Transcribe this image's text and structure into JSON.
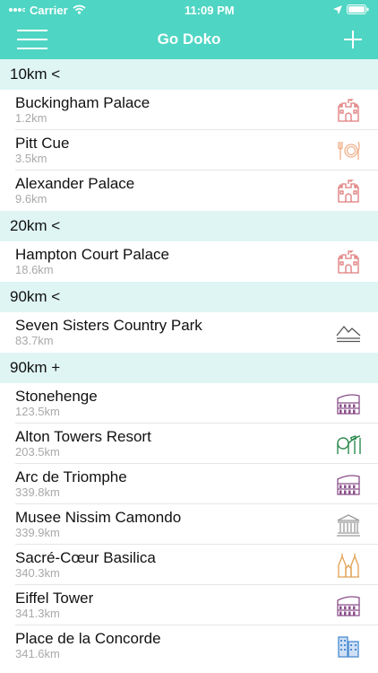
{
  "status": {
    "carrier": "Carrier",
    "time": "11:09 PM"
  },
  "nav": {
    "title": "Go Doko"
  },
  "sections": [
    {
      "header": "10km <",
      "rows": [
        {
          "name": "Buckingham Palace",
          "distance": "1.2km",
          "icon": "castle-icon",
          "color": "#e07a7a"
        },
        {
          "name": "Pitt Cue",
          "distance": "3.5km",
          "icon": "restaurant-icon",
          "color": "#f0b08a"
        },
        {
          "name": "Alexander Palace",
          "distance": "9.6km",
          "icon": "castle-icon",
          "color": "#e07a7a"
        }
      ]
    },
    {
      "header": "20km <",
      "rows": [
        {
          "name": "Hampton Court Palace",
          "distance": "18.6km",
          "icon": "castle-icon",
          "color": "#e07a7a"
        }
      ]
    },
    {
      "header": "90km <",
      "rows": [
        {
          "name": "Seven Sisters Country Park",
          "distance": "83.7km",
          "icon": "mountain-icon",
          "color": "#555555"
        }
      ]
    },
    {
      "header": "90km +",
      "rows": [
        {
          "name": "Stonehenge",
          "distance": "123.5km",
          "icon": "colosseum-icon",
          "color": "#8a4f8a"
        },
        {
          "name": "Alton Towers Resort",
          "distance": "203.5km",
          "icon": "rollercoaster-icon",
          "color": "#2e8a4f"
        },
        {
          "name": "Arc de Triomphe",
          "distance": "339.8km",
          "icon": "colosseum-icon",
          "color": "#8a4f8a"
        },
        {
          "name": "Musee Nissim Camondo",
          "distance": "339.9km",
          "icon": "museum-icon",
          "color": "#9a9a9a"
        },
        {
          "name": "Sacré-Cœur Basilica",
          "distance": "340.3km",
          "icon": "cathedral-icon",
          "color": "#e0a050"
        },
        {
          "name": "Eiffel Tower",
          "distance": "341.3km",
          "icon": "colosseum-icon",
          "color": "#8a4f8a"
        },
        {
          "name": "Place de la Concorde",
          "distance": "341.6km",
          "icon": "buildings-icon",
          "color": "#4a8ad0"
        }
      ]
    }
  ]
}
